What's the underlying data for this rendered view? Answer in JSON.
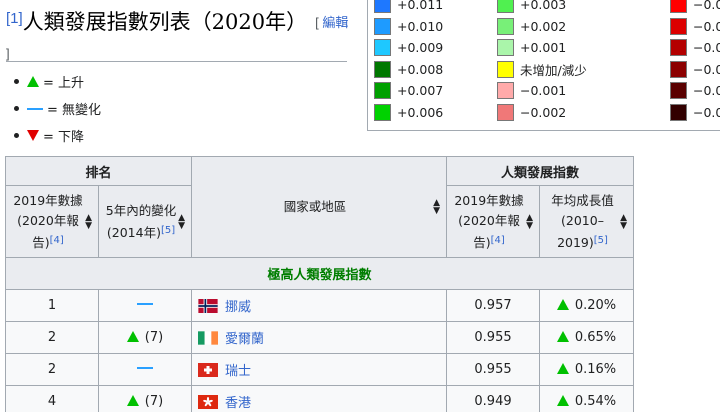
{
  "heading": {
    "ref": "[1]",
    "title": "人類發展指數列表（2020年）",
    "edit_open": "[ ",
    "edit_label": "編輯",
    "edit_close": " ]"
  },
  "legend": [
    {
      "symbol": "up-triangle",
      "color": "#00c000",
      "text": "= 上升"
    },
    {
      "symbol": "dash",
      "color": "#2aa0ff",
      "text": "= 無變化"
    },
    {
      "symbol": "down-triangle",
      "color": "#e00000",
      "text": "= 下降"
    }
  ],
  "color_key": {
    "col1": [
      {
        "color": "#1e78ff",
        "label": "+0.011"
      },
      {
        "color": "#1e9bff",
        "label": "+0.010"
      },
      {
        "color": "#1ec8ff",
        "label": "+0.009"
      },
      {
        "color": "#007800",
        "label": "+0.008"
      },
      {
        "color": "#00a000",
        "label": "+0.007"
      },
      {
        "color": "#00d200",
        "label": "+0.006"
      }
    ],
    "col2": [
      {
        "color": "#50f050",
        "label": "+0.003"
      },
      {
        "color": "#78f078",
        "label": "+0.002"
      },
      {
        "color": "#aaf5aa",
        "label": "+0.001"
      },
      {
        "color": "#ffff00",
        "label": "未增加/減少"
      },
      {
        "color": "#ffaaaa",
        "label": "−0.001"
      },
      {
        "color": "#f07878",
        "label": "−0.002"
      }
    ],
    "col3": [
      {
        "color": "#ff0000",
        "label": "−0.0"
      },
      {
        "color": "#dc0000",
        "label": "−0.0"
      },
      {
        "color": "#b40000",
        "label": "−0.0"
      },
      {
        "color": "#8c0000",
        "label": "−0.0"
      },
      {
        "color": "#5a0000",
        "label": "−0.0"
      },
      {
        "color": "#320000",
        "label": "−0.0"
      }
    ]
  },
  "table": {
    "group_rank": "排名",
    "group_hdi": "人類發展指數",
    "col_country": "國家或地區",
    "col_rank2019": {
      "text": "2019年數據(2020年報告)",
      "sup": "[4]"
    },
    "col_change": {
      "text": "5年內的變化(2014年)",
      "sup": "[5]"
    },
    "col_hdi2019": {
      "text": "2019年數據(2020年報告)",
      "sup": "[4]"
    },
    "col_growth": {
      "text": "年均成長值(2010–2019)",
      "sup": "[5]"
    },
    "category": "極高人類發展指數",
    "rows": [
      {
        "rank": "1",
        "change_type": "none",
        "change": "",
        "flag": "norway",
        "country": "挪威",
        "hdi": "0.957",
        "growth": "0.20%"
      },
      {
        "rank": "2",
        "change_type": "up",
        "change": "(7)",
        "flag": "ireland",
        "country": "愛爾蘭",
        "hdi": "0.955",
        "growth": "0.65%"
      },
      {
        "rank": "2",
        "change_type": "none",
        "change": "",
        "flag": "switzerland",
        "country": "瑞士",
        "hdi": "0.955",
        "growth": "0.16%"
      },
      {
        "rank": "4",
        "change_type": "up",
        "change": "(7)",
        "flag": "hongkong",
        "country": "香港",
        "hdi": "0.949",
        "growth": "0.54%"
      }
    ]
  }
}
